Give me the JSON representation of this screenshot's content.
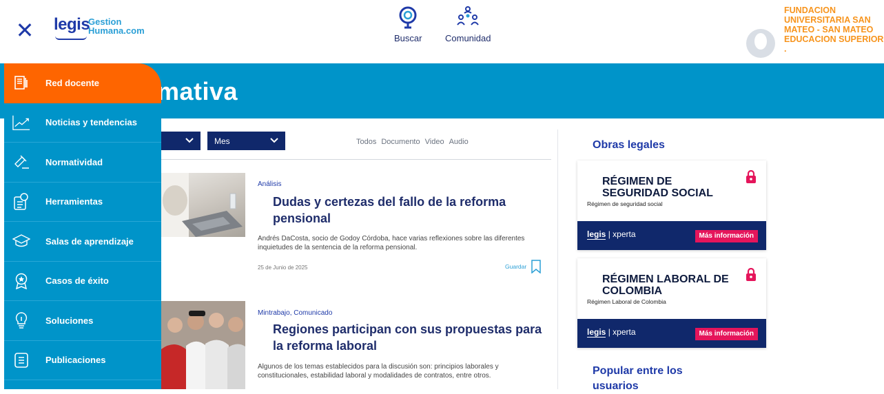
{
  "header": {
    "logo_main": "legis",
    "logo_sub_1": "Gestion",
    "logo_sub_2": "Humana.com",
    "nav": [
      {
        "label": "Buscar",
        "icon": "search-icon"
      },
      {
        "label": "Comunidad",
        "icon": "community-icon"
      }
    ],
    "organization": "FUNDACION UNIVERSITARIA SAN MATEO - SAN MATEO EDUCACION SUPERIOR ."
  },
  "banner": {
    "title": "mativa"
  },
  "sidebar": {
    "items": [
      {
        "label": "Red docente",
        "icon": "network-icon",
        "active": true
      },
      {
        "label": "Noticias y tendencias",
        "icon": "trend-icon"
      },
      {
        "label": "Normatividad",
        "icon": "gavel-icon"
      },
      {
        "label": "Herramientas",
        "icon": "tools-icon"
      },
      {
        "label": "Salas de aprendizaje",
        "icon": "graduation-cap-icon"
      },
      {
        "label": "Casos de éxito",
        "icon": "medal-icon"
      },
      {
        "label": "Soluciones",
        "icon": "lightbulb-icon"
      },
      {
        "label": "Publicaciones",
        "icon": "publication-icon"
      }
    ]
  },
  "filters": {
    "select_1": "",
    "select_2": "Mes",
    "types": [
      "Todos",
      "Documento",
      "Video",
      "Audio"
    ]
  },
  "articles": [
    {
      "category": "Análisis",
      "title": "Dudas y certezas del fallo de la reforma pensional",
      "description": "Andrés DaCosta, socio de Godoy Córdoba, hace varias reflexiones sobre las diferentes inquietudes de la sentencia de la reforma pensional.",
      "date": "25 de Junio de 2025",
      "save_label": "Guardar"
    },
    {
      "category": "Mintrabajo, Comunicado",
      "title": "Regiones participan con sus propuestas para la reforma laboral",
      "description": "Algunos de los temas establecidos para la discusión son: principios laborales y constitucionales, estabilidad laboral y modalidades de contratos, entre otros."
    }
  ],
  "right": {
    "obras_title": "Obras legales",
    "cards": [
      {
        "title": "RÉGIMEN DE SEGURIDAD SOCIAL",
        "subtitle": "Régimen de seguridad social",
        "brand_a": "legis",
        "brand_b": "xperta",
        "button": "Más información"
      },
      {
        "title": "RÉGIMEN LABORAL DE COLOMBIA",
        "subtitle": "Régimen Laboral de Colombia",
        "brand_a": "legis",
        "brand_b": "xperta",
        "button": "Más información"
      }
    ],
    "popular_title": "Popular entre los usuarios"
  },
  "colors": {
    "accent_orange": "#fe6500",
    "brand_blue": "#0094c9",
    "navy": "#10286b",
    "info_pink": "#e5155b"
  }
}
